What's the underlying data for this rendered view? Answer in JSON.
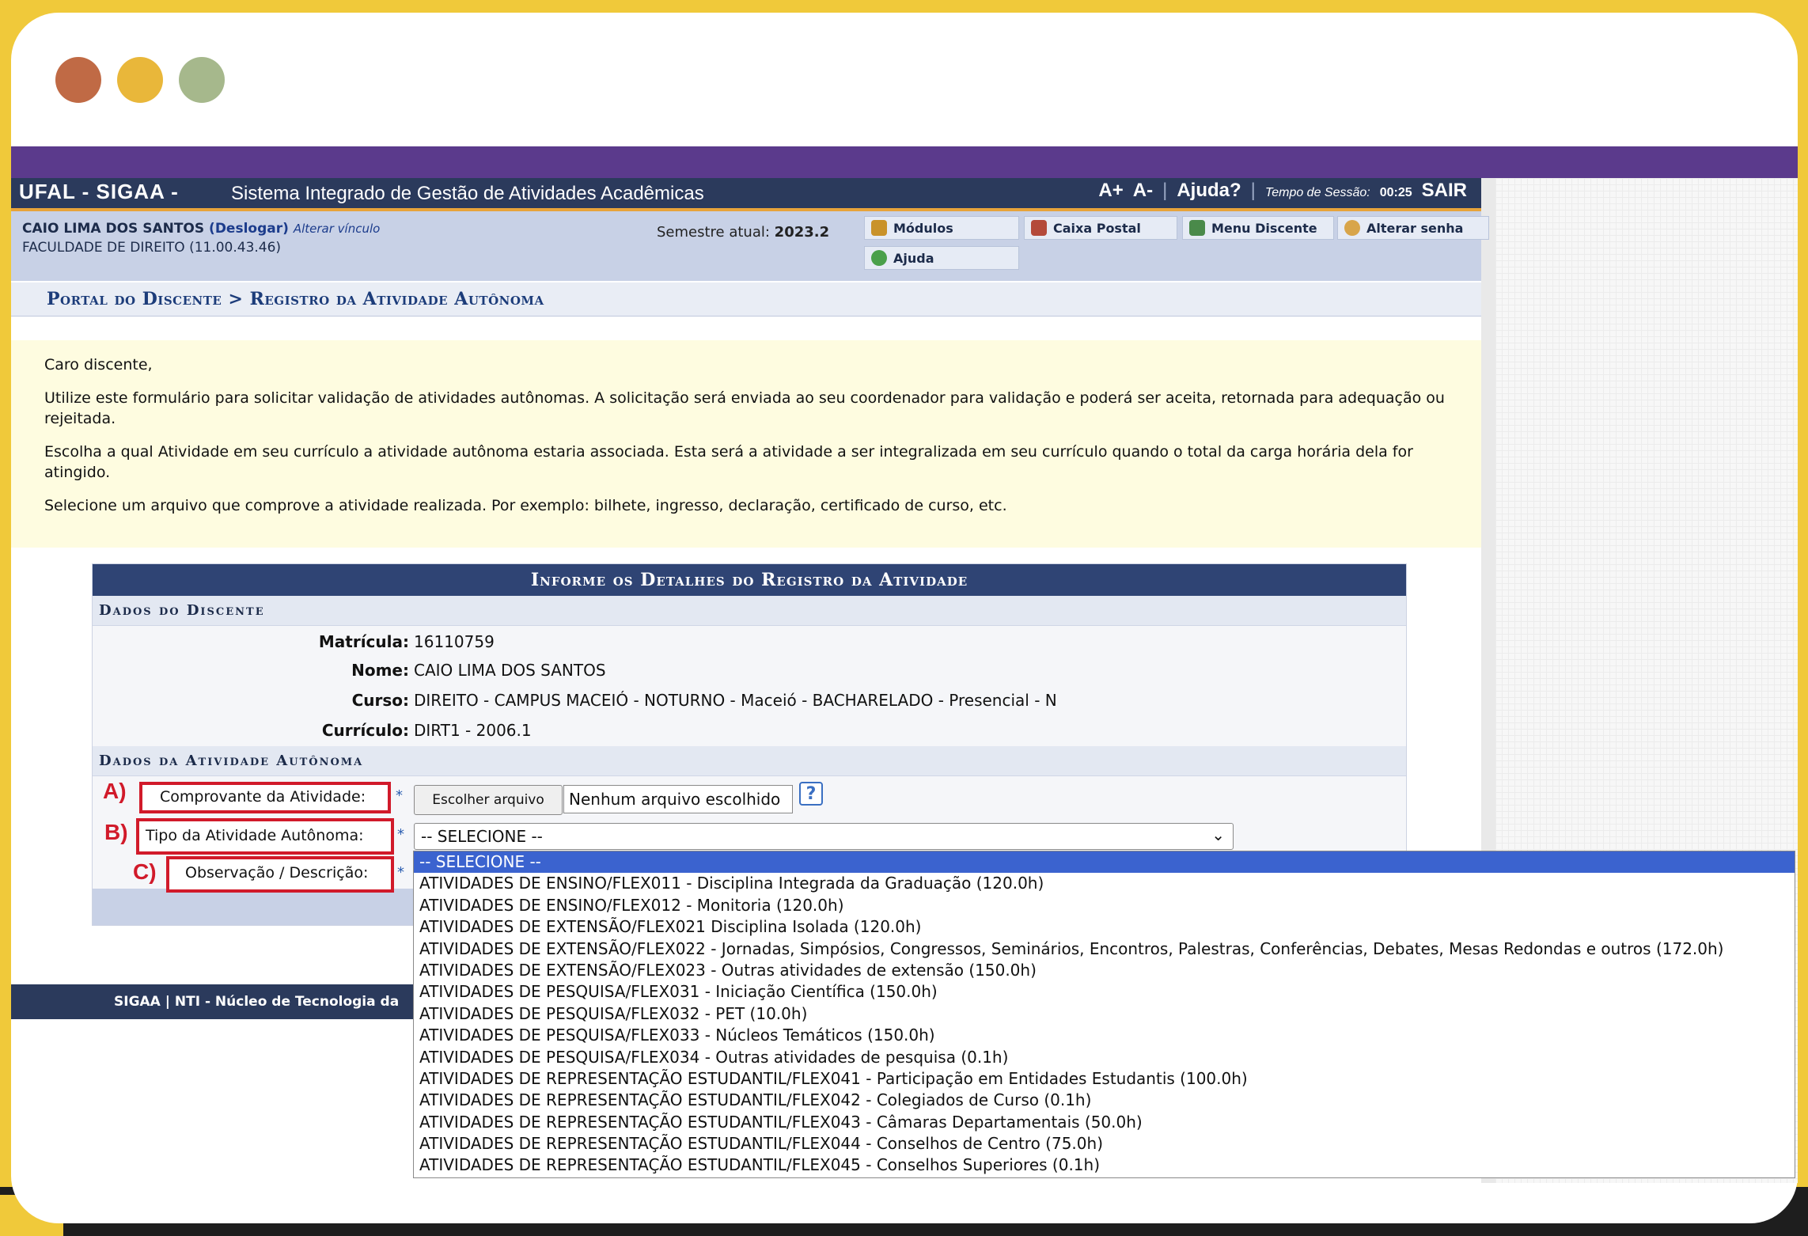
{
  "window": {
    "dots": [
      {
        "name": "close",
        "color": "#c06a45"
      },
      {
        "name": "minimize",
        "color": "#e9b73a"
      },
      {
        "name": "maximize",
        "color": "#a6b88c"
      }
    ]
  },
  "header": {
    "brand": "UFAL - SIGAA -",
    "subtitle": "Sistema Integrado de Gestão de Atividades Acadêmicas",
    "font_plus": "A+",
    "font_minus": "A-",
    "separator": "|",
    "help": "Ajuda?",
    "session_label": "Tempo de Sessão:",
    "session_time": "00:25",
    "logout": "SAIR"
  },
  "user": {
    "name": "CAIO LIMA DOS SANTOS",
    "logout_link": "(Deslogar)",
    "change_link": "Alterar vínculo",
    "faculty": "FACULDADE DE DIREITO (11.00.43.46)",
    "semester_label": "Semestre atual:",
    "semester_value": "2023.2"
  },
  "menu": {
    "modules": "Módulos",
    "mailbox": "Caixa Postal",
    "student_menu": "Menu Discente",
    "change_password": "Alterar senha",
    "help": "Ajuda"
  },
  "breadcrumb": "Portal do Discente > Registro da Atividade Autônoma",
  "instructions": {
    "greeting": "Caro discente,",
    "p1": "Utilize este formulário para solicitar validação de atividades autônomas. A solicitação será enviada ao seu coordenador para validação e poderá ser aceita, retornada para adequação ou rejeitada.",
    "p2": "Escolha a qual Atividade em seu currículo a atividade autônoma estaria associada. Esta será a atividade a ser integralizada em seu currículo quando o total da carga horária dela for atingido.",
    "p3": "Selecione um arquivo que comprove a atividade realizada. Por exemplo: bilhete, ingresso, declaração, certificado de curso, etc."
  },
  "form": {
    "title": "Informe os Detalhes do Registro da Atividade",
    "section_student": "Dados do Discente",
    "matricula_label": "Matrícula:",
    "matricula_value": "16110759",
    "nome_label": "Nome:",
    "nome_value": "CAIO LIMA DOS SANTOS",
    "curso_label": "Curso:",
    "curso_value": "DIREITO - CAMPUS MACEIÓ - NOTURNO - Maceió - BACHARELADO - Presencial - N",
    "curriculo_label": "Currículo:",
    "curriculo_value": "DIRT1 - 2006.1",
    "section_activity": "Dados da Atividade Autônoma",
    "comprovante_label": "Comprovante da Atividade:",
    "tipo_label": "Tipo da Atividade Autônoma:",
    "obs_label": "Observação / Descrição:",
    "required_mark": "*",
    "file_button": "Escolher arquivo",
    "file_none": "Nenhum arquivo escolhido",
    "help_icon": "?",
    "select_value": "-- SELECIONE --",
    "markers": {
      "a": "A)",
      "b": "B)",
      "c": "C)"
    }
  },
  "dropdown_options": [
    "-- SELECIONE --",
    "ATIVIDADES DE ENSINO/FLEX011 - Disciplina Integrada da Graduação (120.0h)",
    "ATIVIDADES DE ENSINO/FLEX012 - Monitoria (120.0h)",
    "ATIVIDADES DE EXTENSÃO/FLEX021 Disciplina Isolada (120.0h)",
    "ATIVIDADES DE EXTENSÃO/FLEX022 - Jornadas, Simpósios, Congressos, Seminários, Encontros, Palestras, Conferências, Debates, Mesas Redondas e outros (172.0h)",
    "ATIVIDADES DE EXTENSÃO/FLEX023 - Outras atividades de extensão (150.0h)",
    "ATIVIDADES DE PESQUISA/FLEX031 - Iniciação Científica (150.0h)",
    "ATIVIDADES DE PESQUISA/FLEX032 - PET (10.0h)",
    "ATIVIDADES DE PESQUISA/FLEX033 - Núcleos Temáticos (150.0h)",
    "ATIVIDADES DE PESQUISA/FLEX034 - Outras atividades de pesquisa (0.1h)",
    "ATIVIDADES DE REPRESENTAÇÃO ESTUDANTIL/FLEX041 - Participação em Entidades Estudantis (100.0h)",
    "ATIVIDADES DE REPRESENTAÇÃO ESTUDANTIL/FLEX042 - Colegiados de Curso (0.1h)",
    "ATIVIDADES DE REPRESENTAÇÃO ESTUDANTIL/FLEX043 - Câmaras Departamentais (50.0h)",
    "ATIVIDADES DE REPRESENTAÇÃO ESTUDANTIL/FLEX044 - Conselhos de Centro (75.0h)",
    "ATIVIDADES DE REPRESENTAÇÃO ESTUDANTIL/FLEX045 - Conselhos Superiores (0.1h)"
  ],
  "footer": {
    "text": "SIGAA | NTI - Núcleo de Tecnologia da"
  }
}
